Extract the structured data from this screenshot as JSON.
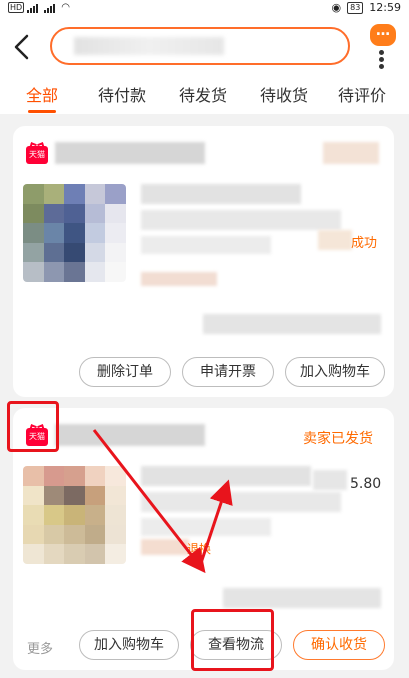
{
  "status_bar": {
    "left_tags": [
      "HD",
      "2"
    ],
    "battery": "83",
    "time": "12:59"
  },
  "header": {
    "search_placeholder": "",
    "more_badge": "…"
  },
  "tabs": [
    {
      "label": "全部",
      "active": true
    },
    {
      "label": "待付款",
      "active": false
    },
    {
      "label": "待发货",
      "active": false
    },
    {
      "label": "待收货",
      "active": false
    },
    {
      "label": "待评价",
      "active": false
    }
  ],
  "orders": [
    {
      "shop_logo": "天猫",
      "status": "成功",
      "actions": [
        "删除订单",
        "申请开票",
        "加入购物车"
      ]
    },
    {
      "shop_logo": "天猫",
      "status": "卖家已发货",
      "price_fragment": "5.80",
      "tag": "退换",
      "more": "更多",
      "actions": [
        "加入购物车",
        "查看物流",
        "确认收货"
      ]
    }
  ],
  "colors": {
    "accent": "#ff5000",
    "tmall_red": "#ff0036",
    "annotation_red": "#e8141c"
  }
}
